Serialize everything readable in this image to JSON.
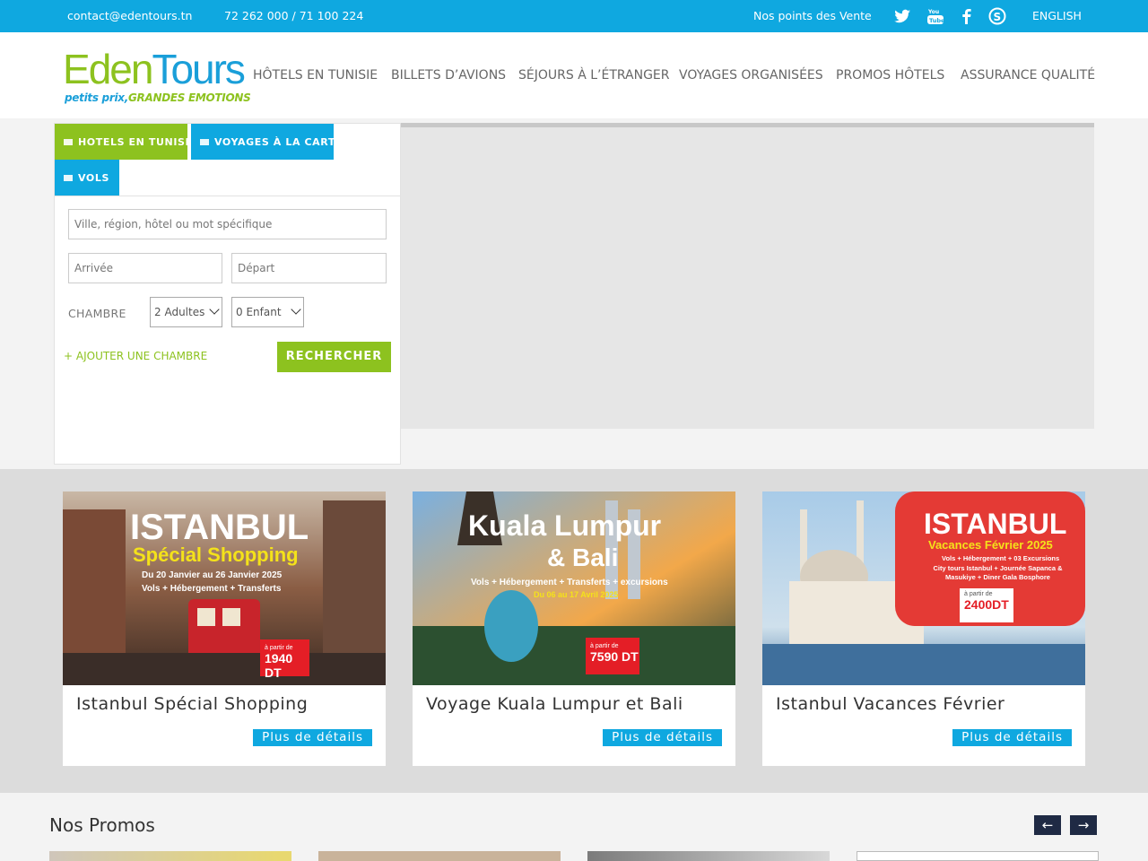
{
  "topbar": {
    "email": "contact@edentours.tn",
    "phone": "72 262 000 / 71 100 224",
    "points_vente": "Nos points des Vente",
    "language": "ENGLISH",
    "social_icons": [
      "twitter-icon",
      "youtube-icon",
      "facebook-icon",
      "skype-icon"
    ]
  },
  "header": {
    "logo_e": "E",
    "logo_den": "den",
    "logo_t": "T",
    "logo_ours": "ours",
    "logo_tag_1": "petits prix,",
    "logo_tag_2": "GRANDES EMOTIONS",
    "nav": [
      "HÔTELS EN TUNISIE",
      "BILLETS D’AVIONS",
      "SÉJOURS À L’ÉTRANGER",
      "VOYAGES ORGANISÉES",
      "PROMOS HÔTELS",
      "ASSURANCE QUALITÉ"
    ]
  },
  "search": {
    "tabs": [
      "HOTELS EN TUNISIE",
      "VOYAGES À LA CARTE",
      "VOLS"
    ],
    "destination_placeholder": "Ville, région, hôtel ou mot spécifique",
    "arrival_placeholder": "Arrivée",
    "departure_placeholder": "Départ",
    "room_label": "CHAMBRE",
    "adults": "2 Adultes",
    "children": "0 Enfant",
    "add_room": "+ AJOUTER UNE CHAMBRE",
    "search_button": "RECHERCHER"
  },
  "offers": [
    {
      "title": "Istanbul Spécial Shopping",
      "button": "Plus de détails",
      "img_line1": "ISTANBUL",
      "img_line2": "Spécial Shopping",
      "img_line3": "Du 20 Janvier au 26 Janvier 2025",
      "img_line4": "Vols + Hébergement + Transferts",
      "price_small": "à partir de",
      "price": "1940 DT"
    },
    {
      "title": "Voyage Kuala Lumpur et Bali",
      "button": "Plus de détails",
      "img_line1": "Kuala Lumpur",
      "img_line2": "& Bali",
      "img_line3": "Vols + Hébergement + Transferts + excursions",
      "img_line4": "Du 06 au 17 Avril 2025",
      "price_small": "à partir de",
      "price": "7590 DT"
    },
    {
      "title": "Istanbul Vacances Février",
      "button": "Plus de détails",
      "img_line1": "ISTANBUL",
      "img_line2": "Vacances Février 2025",
      "img_line3": "Vols + Hébergement + 03 Excursions",
      "img_line4": "City tours Istanbul + Journée Sapanca & Masukiye + Diner Gala Bosphore",
      "price_small": "à partir de",
      "price": "2400DT"
    }
  ],
  "promos": {
    "title": "Nos Promos",
    "prev": "←",
    "next": "→"
  },
  "colors": {
    "topbar": "#0fa8e0",
    "green": "#8dc21f",
    "blue": "#0fa8e0",
    "navy": "#1f2a44"
  }
}
